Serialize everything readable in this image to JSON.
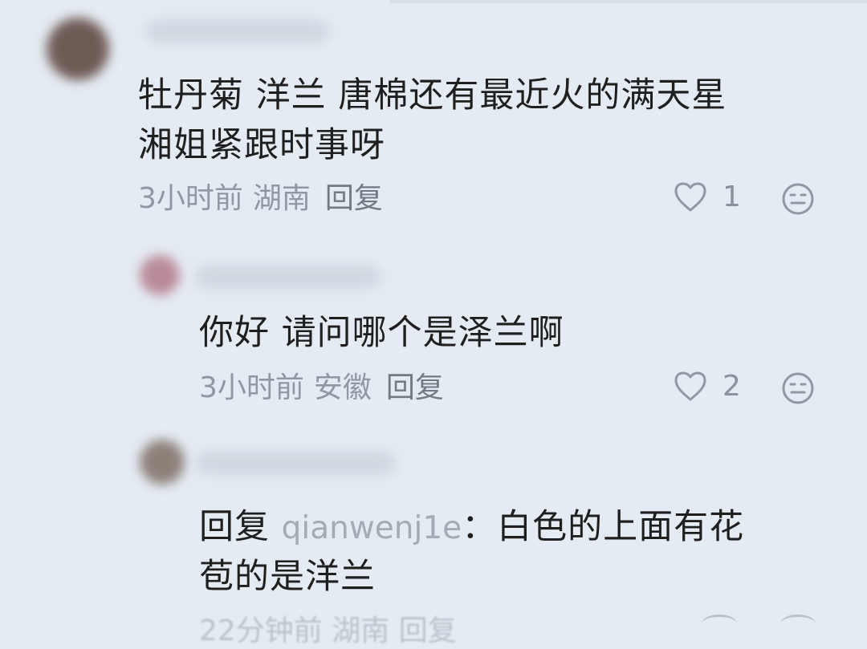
{
  "comments": [
    {
      "text_lines": [
        "牡丹菊 洋兰 唐棉还有最近火的满天星",
        "湘姐紧跟时事呀"
      ],
      "time": "3小时前",
      "location": "湖南",
      "reply_label": "回复",
      "likes": "1",
      "avatar_color": "#6f5b56"
    },
    {
      "text": "你好 请问哪个是泽兰啊",
      "time": "3小时前",
      "location": "安徽",
      "reply_label": "回复",
      "likes": "2",
      "avatar_color": "#b98a99"
    },
    {
      "reply_prefix": "回复",
      "mention": "qianwenj1e",
      "separator": "：",
      "text_line_1": "白色的上面有花",
      "text_line_2": "苞的是洋兰",
      "avatar_color": "#8d8079",
      "faded_meta": "22分钟前 湖南 回复"
    }
  ],
  "icons": {
    "like": "heart-outline-icon",
    "emoji": "emoji-face-icon"
  },
  "colors": {
    "background": "#e5ebf3",
    "text": "#1f1f1f",
    "meta": "#8f98a4"
  }
}
